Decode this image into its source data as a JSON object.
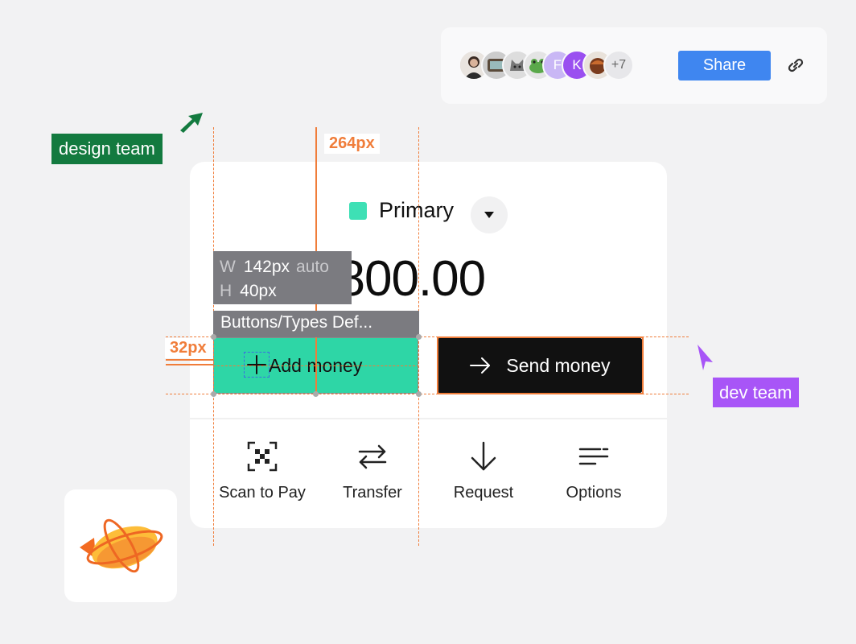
{
  "share": {
    "overflow_count": "+7",
    "button_label": "Share",
    "avatars": [
      {
        "icon": "person-photo-avatar",
        "text": ""
      },
      {
        "icon": "tv-avatar",
        "text": ""
      },
      {
        "icon": "cat-avatar",
        "text": ""
      },
      {
        "icon": "frog-avatar",
        "text": ""
      },
      {
        "icon": "letter-avatar",
        "text": "F"
      },
      {
        "icon": "letter-avatar",
        "text": "K"
      },
      {
        "icon": "food-avatar",
        "text": ""
      }
    ]
  },
  "tags": {
    "design": "design team",
    "dev": "dev team"
  },
  "card": {
    "account_name": "Primary",
    "amount": "$800.00",
    "add_money": "Add money",
    "send_money": "Send money",
    "actions": [
      {
        "label": "Scan to Pay",
        "icon": "qr-scan-icon"
      },
      {
        "label": "Transfer",
        "icon": "transfer-arrows-icon"
      },
      {
        "label": "Request",
        "icon": "arrow-down-icon"
      },
      {
        "label": "Options",
        "icon": "options-lines-icon"
      }
    ]
  },
  "inspector": {
    "width_measure": "264px",
    "padding_measure": "32px",
    "w_key": "W",
    "w_value": "142px",
    "w_mode": "auto",
    "h_key": "H",
    "h_value": "40px",
    "component_name": "Buttons/Types Def..."
  },
  "colors": {
    "accent_green": "#2ed6a6",
    "share_blue": "#3f86f0",
    "guide_orange": "#f07d3a",
    "design_tag": "#137a3f",
    "dev_tag": "#a855f7"
  }
}
